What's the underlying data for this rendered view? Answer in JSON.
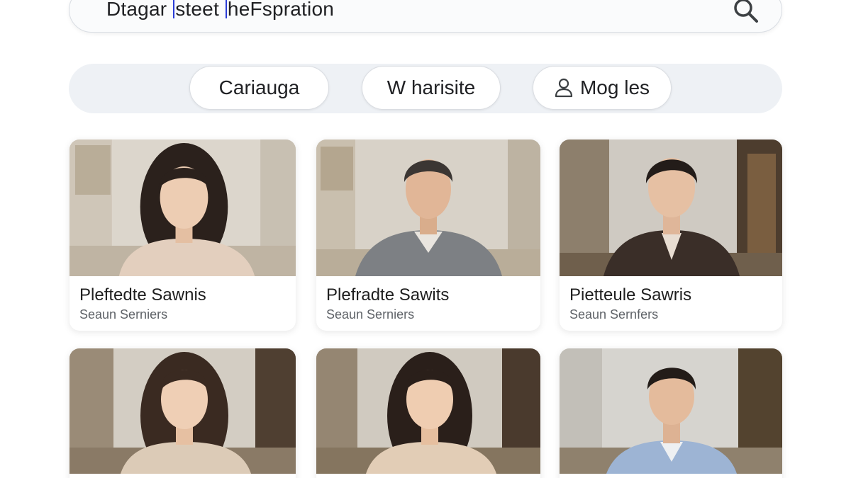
{
  "search": {
    "part1": "Dtagar ",
    "part2": "steet ",
    "part3": "heFspration"
  },
  "filters": [
    {
      "label": "Cariauga"
    },
    {
      "label": "W harisite"
    },
    {
      "label": "Mog les",
      "icon": "person-icon"
    }
  ],
  "results": [
    {
      "name": "Pleftedte Sawnis",
      "subtitle": "Seaun Serniers"
    },
    {
      "name": "Plefradte Sawits",
      "subtitle": "Seaun Serniers"
    },
    {
      "name": "Pietteule Sawris",
      "subtitle": "Seaun Sernfers"
    },
    {
      "name": "",
      "subtitle": ""
    },
    {
      "name": "",
      "subtitle": ""
    },
    {
      "name": "",
      "subtitle": ""
    }
  ],
  "colors": {
    "caret": "#2a3cd6",
    "strip": "#eef1f5",
    "text": "#202124",
    "subtext": "#5f6368"
  }
}
